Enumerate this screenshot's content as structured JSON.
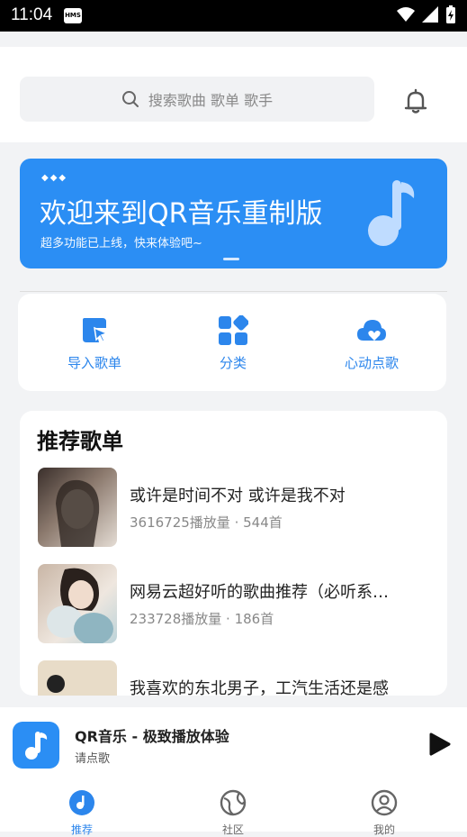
{
  "status_bar": {
    "time": "11:04",
    "hms_label": "HMS"
  },
  "header": {
    "search_placeholder": "搜索歌曲 歌单 歌手"
  },
  "banner": {
    "title": "欢迎来到QR音乐重制版",
    "subtitle": "超多功能已上线，快来体验吧~"
  },
  "quick_actions": [
    {
      "label": "导入歌单"
    },
    {
      "label": "分类"
    },
    {
      "label": "心动点歌"
    }
  ],
  "recommend": {
    "title": "推荐歌单",
    "playlists": [
      {
        "title": "或许是时间不对 或许是我不对",
        "meta": "3616725播放量 · 544首"
      },
      {
        "title": "网易云超好听的歌曲推荐（必听系…",
        "meta": "233728播放量 · 186首"
      },
      {
        "title": "我喜欢的东北男子，工汽生活还是感",
        "meta": ""
      }
    ]
  },
  "player": {
    "title": "QR音乐 - 极致播放体验",
    "subtitle": "请点歌"
  },
  "bottom_nav": [
    {
      "label": "推荐",
      "active": true
    },
    {
      "label": "社区",
      "active": false
    },
    {
      "label": "我的",
      "active": false
    }
  ],
  "colors": {
    "accent": "#2b8ef4",
    "accent_text": "#2c86ec"
  }
}
